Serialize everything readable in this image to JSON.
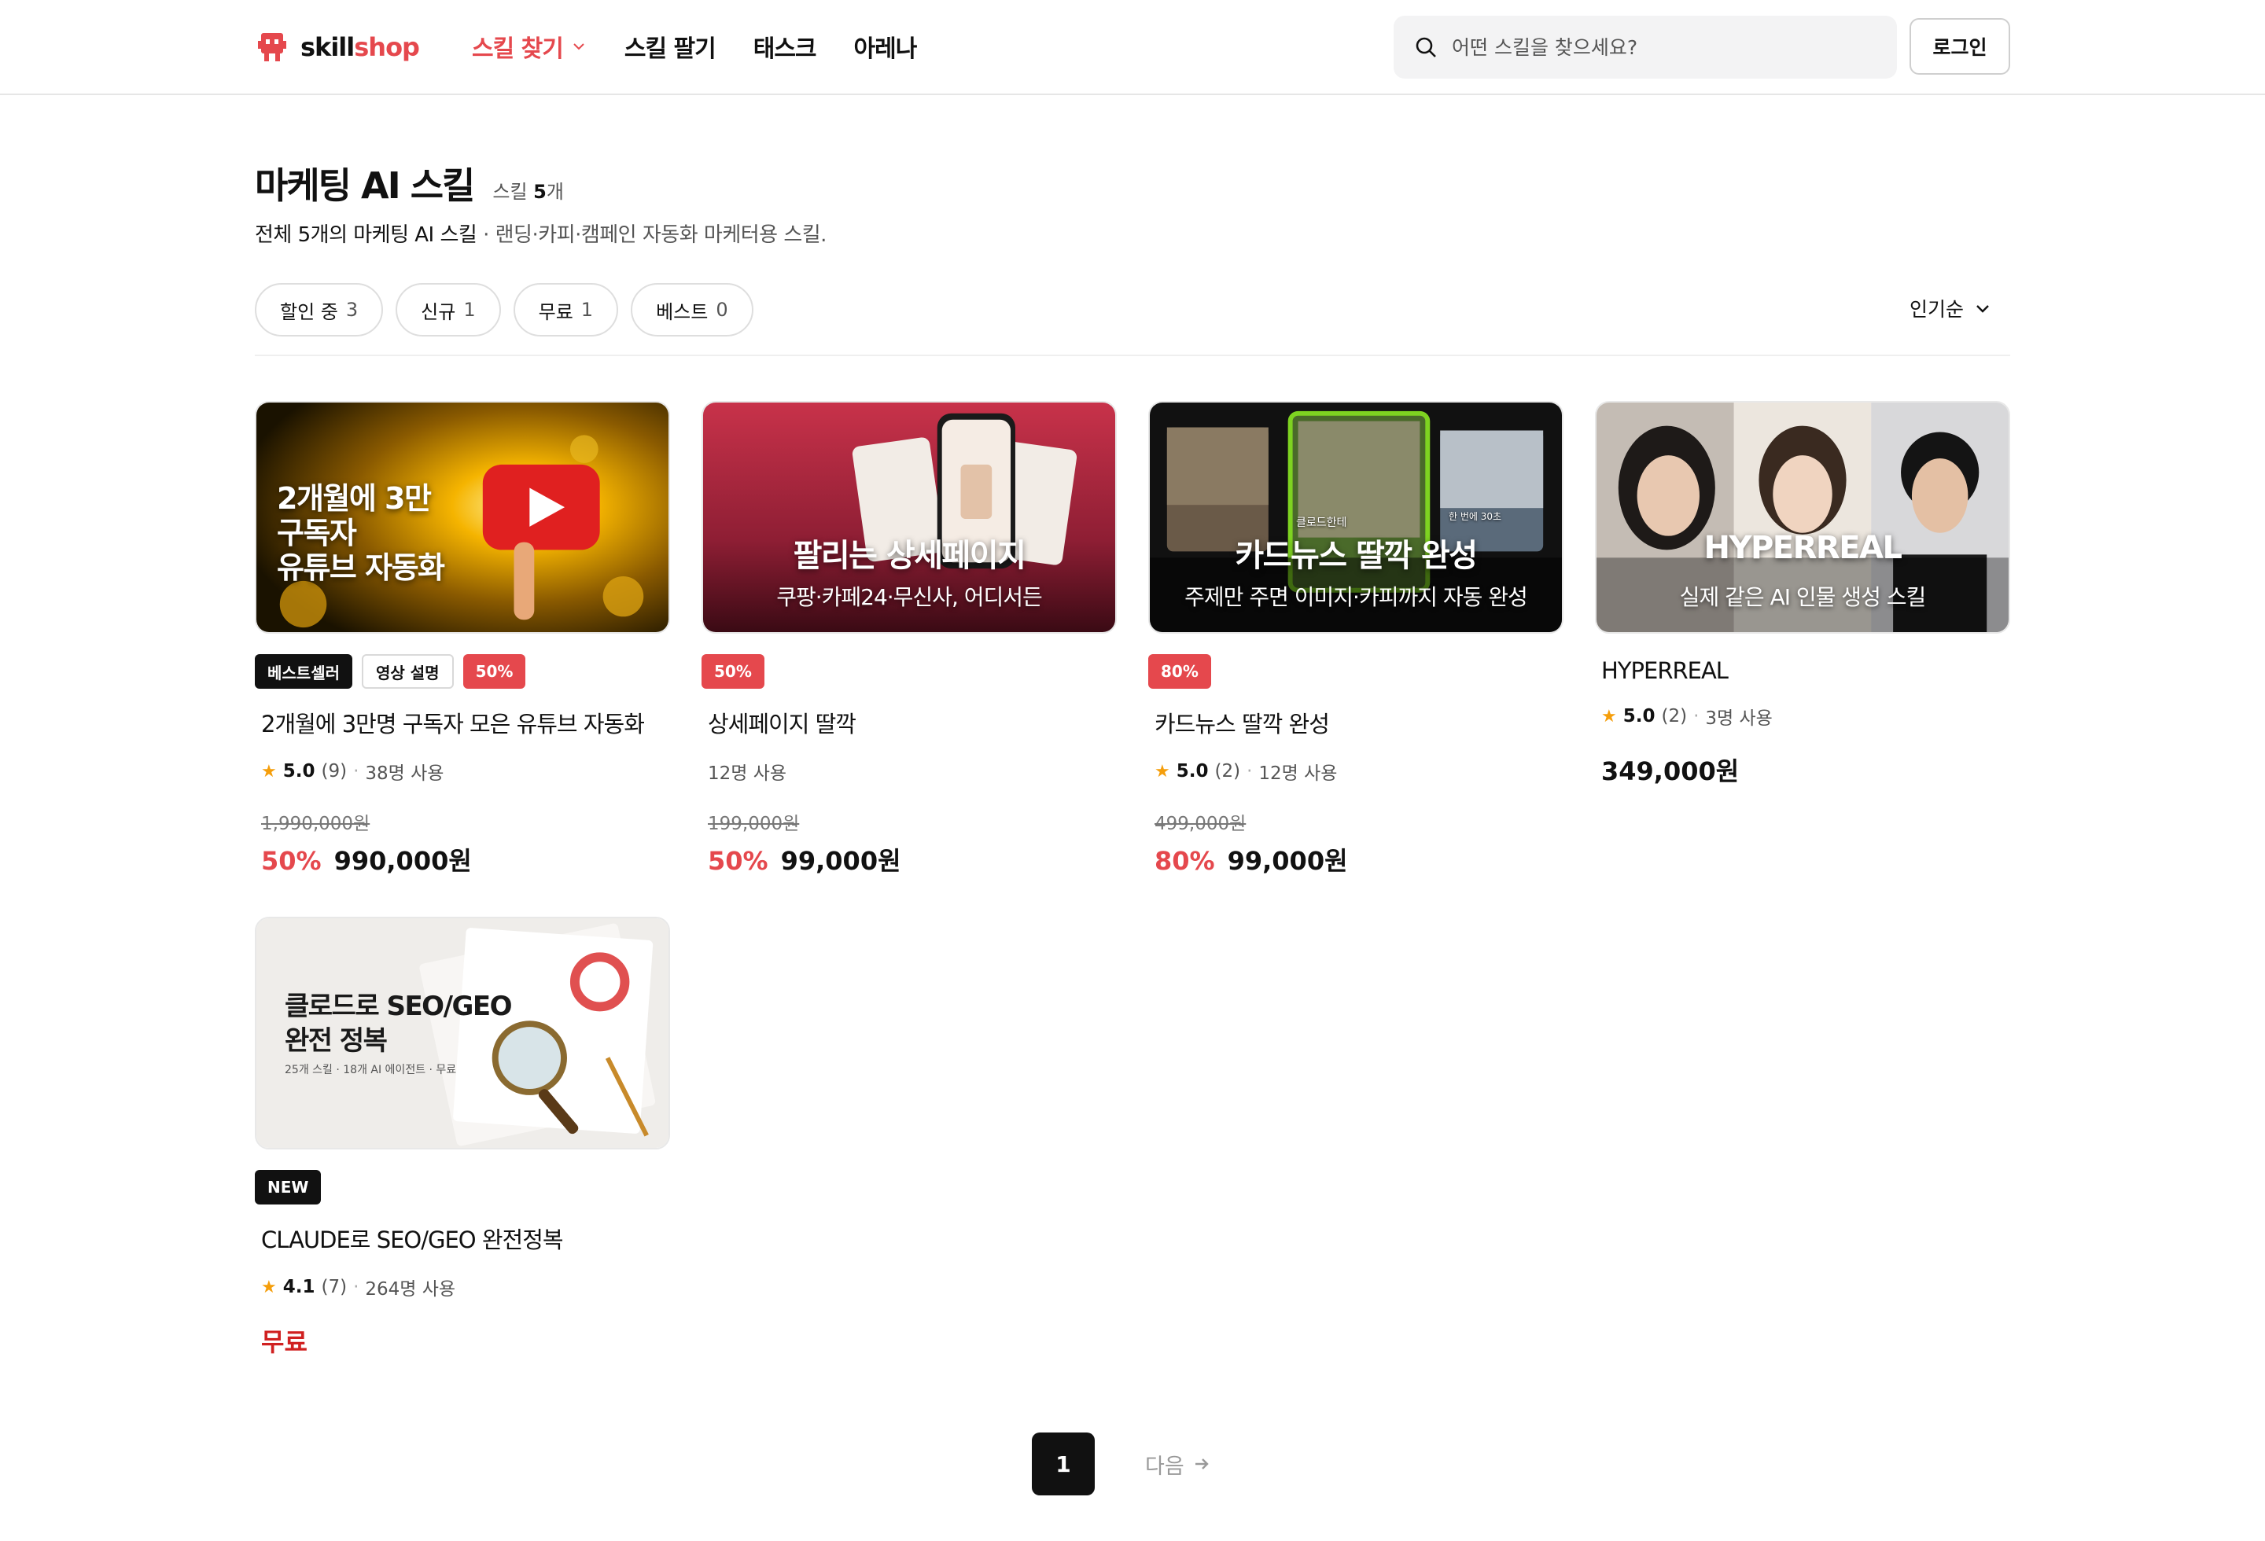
{
  "header": {
    "logo_prefix": "skill",
    "logo_suffix": "shop",
    "nav": [
      {
        "label": "스킬 찾기",
        "active": true
      },
      {
        "label": "스킬 팔기"
      },
      {
        "label": "태스크"
      },
      {
        "label": "아레나"
      }
    ],
    "search_placeholder": "어떤 스킬을 찾으세요?",
    "login_label": "로그인"
  },
  "page": {
    "title": "마케팅 AI 스킬",
    "count_prefix": "스킬",
    "count_value": "5",
    "count_suffix": "개",
    "subtitle_strong": "전체 5개의 마케팅 AI 스킬",
    "subtitle_rest": " · 랜딩·카피·캠페인 자동화 마케터용 스킬."
  },
  "filters": [
    {
      "label": "할인 중",
      "count": "3"
    },
    {
      "label": "신규",
      "count": "1"
    },
    {
      "label": "무료",
      "count": "1"
    },
    {
      "label": "베스트",
      "count": "0"
    }
  ],
  "sort": {
    "label": "인기순"
  },
  "products": [
    {
      "thumb_text": [
        "2개월에 3만",
        "구독자",
        "유튜브 자동화"
      ],
      "badges": [
        {
          "label": "베스트셀러",
          "style": "dark"
        },
        {
          "label": "영상 설명",
          "style": "outline"
        },
        {
          "label": "50%",
          "style": "red"
        }
      ],
      "title": "2개월에 3만명 구독자 모은 유튜브 자동화",
      "rating": "5.0",
      "reviews": "(9)",
      "users": "38명 사용",
      "original_price": "1,990,000원",
      "discount": "50%",
      "price": "990,000원"
    },
    {
      "thumb_title": "팔리는 상세페이지",
      "thumb_sub": "쿠팡·카페24·무신사, 어디서든",
      "badges": [
        {
          "label": "50%",
          "style": "red"
        }
      ],
      "title": "상세페이지 딸깍",
      "users": "12명 사용",
      "original_price": "199,000원",
      "discount": "50%",
      "price": "99,000원"
    },
    {
      "thumb_title": "카드뉴스 딸깍 완성",
      "thumb_sub": "주제만 주면 이미지·카피까지 자동 완성",
      "thumb_card_a": "클로드한테",
      "thumb_card_b": "한 번에 30초",
      "badges": [
        {
          "label": "80%",
          "style": "red"
        }
      ],
      "title": "카드뉴스 딸깍 완성",
      "rating": "5.0",
      "reviews": "(2)",
      "users": "12명 사용",
      "original_price": "499,000원",
      "discount": "80%",
      "price": "99,000원"
    },
    {
      "thumb_title": "HYPERREAL",
      "thumb_sub": "실제 같은 AI 인물 생성 스킬",
      "title": "HYPERREAL",
      "rating": "5.0",
      "reviews": "(2)",
      "users": "3명 사용",
      "price": "349,000원"
    },
    {
      "thumb_title": [
        "클로드로 SEO/GEO",
        "완전 정복"
      ],
      "thumb_sub": "25개 스킬 · 18개 AI 에이전트 · 무료",
      "badges": [
        {
          "label": "NEW",
          "style": "dark"
        }
      ],
      "title": "CLAUDE로 SEO/GEO 완전정복",
      "rating": "4.1",
      "reviews": "(7)",
      "users": "264명 사용",
      "price": "무료"
    }
  ],
  "pagination": {
    "current": "1",
    "next_label": "다음"
  },
  "colors": {
    "accent": "#e5484d",
    "dark": "#111111",
    "star": "#f59e0b"
  }
}
